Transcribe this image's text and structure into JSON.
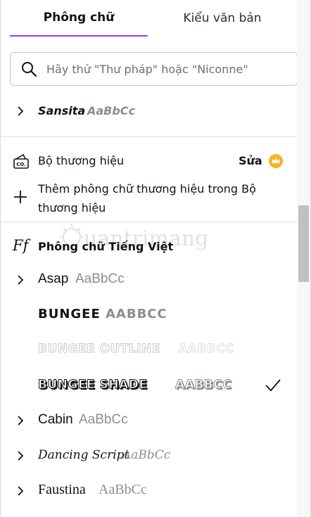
{
  "tabs": [
    {
      "label": "Phông chữ",
      "active": true
    },
    {
      "label": "Kiểu văn bản",
      "active": false
    }
  ],
  "search": {
    "placeholder": "Hãy thử \"Thư pháp\" hoặc \"Niconne\"",
    "value": ""
  },
  "fonts_top": [
    {
      "name": "Sansita",
      "sample": "AaBbCc",
      "expandable": true
    }
  ],
  "brand": {
    "title": "Bộ thương hiệu",
    "edit_label": "Sửa",
    "add_label": "Thêm phông chữ thương hiệu trong Bộ thương hiệu"
  },
  "vietnamese_section": {
    "icon_text": "Ff",
    "title": "Phông chữ Tiếng Việt",
    "fonts": [
      {
        "name": "Asap",
        "sample": "AaBbCc",
        "expandable": true,
        "selected": false
      },
      {
        "name": "BUNGEE",
        "sample": "AABBCC",
        "expandable": false,
        "selected": false
      },
      {
        "name": "BUNGEE OUTLINE",
        "sample": "AABBCC",
        "expandable": false,
        "selected": false
      },
      {
        "name": "BUNGEE SHADE",
        "sample": "AABBCC",
        "expandable": false,
        "selected": true
      },
      {
        "name": "Cabin",
        "sample": "AaBbCc",
        "expandable": true,
        "selected": false
      },
      {
        "name": "Dancing Script",
        "sample": "AaBbCc",
        "expandable": true,
        "selected": false
      },
      {
        "name": "Faustina",
        "sample": "AaBbCc",
        "expandable": true,
        "selected": false
      }
    ]
  },
  "watermark": {
    "text": "uantrimang"
  },
  "colors": {
    "accent": "#8b3dff",
    "crown": "#f6b51e",
    "text": "#0e1318",
    "sample": "#8a8e93"
  }
}
